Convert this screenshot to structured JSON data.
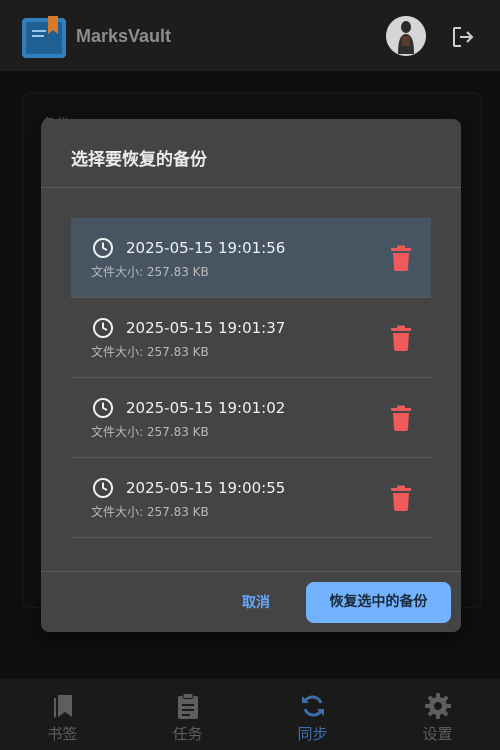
{
  "app": {
    "title": "MarksVault"
  },
  "background": {
    "card_title": "备份..."
  },
  "dialog": {
    "title": "选择要恢复的备份",
    "cancel_label": "取消",
    "restore_label": "恢复选中的备份",
    "backups": [
      {
        "time": "2025-05-15 19:01:56",
        "size": "文件大小: 257.83 KB",
        "selected": true
      },
      {
        "time": "2025-05-15 19:01:37",
        "size": "文件大小: 257.83 KB",
        "selected": false
      },
      {
        "time": "2025-05-15 19:01:02",
        "size": "文件大小: 257.83 KB",
        "selected": false
      },
      {
        "time": "2025-05-15 19:00:55",
        "size": "文件大小: 257.83 KB",
        "selected": false
      }
    ]
  },
  "nav": {
    "items": [
      {
        "label": "书签",
        "icon": "bookmark-icon",
        "active": false
      },
      {
        "label": "任务",
        "icon": "clipboard-icon",
        "active": false
      },
      {
        "label": "同步",
        "icon": "sync-icon",
        "active": true
      },
      {
        "label": "设置",
        "icon": "gear-icon",
        "active": false
      }
    ]
  },
  "colors": {
    "accent": "#72b2ff",
    "delete": "#f05a5a",
    "nav_active": "#3f6fa8",
    "selected_row": "#475563"
  }
}
